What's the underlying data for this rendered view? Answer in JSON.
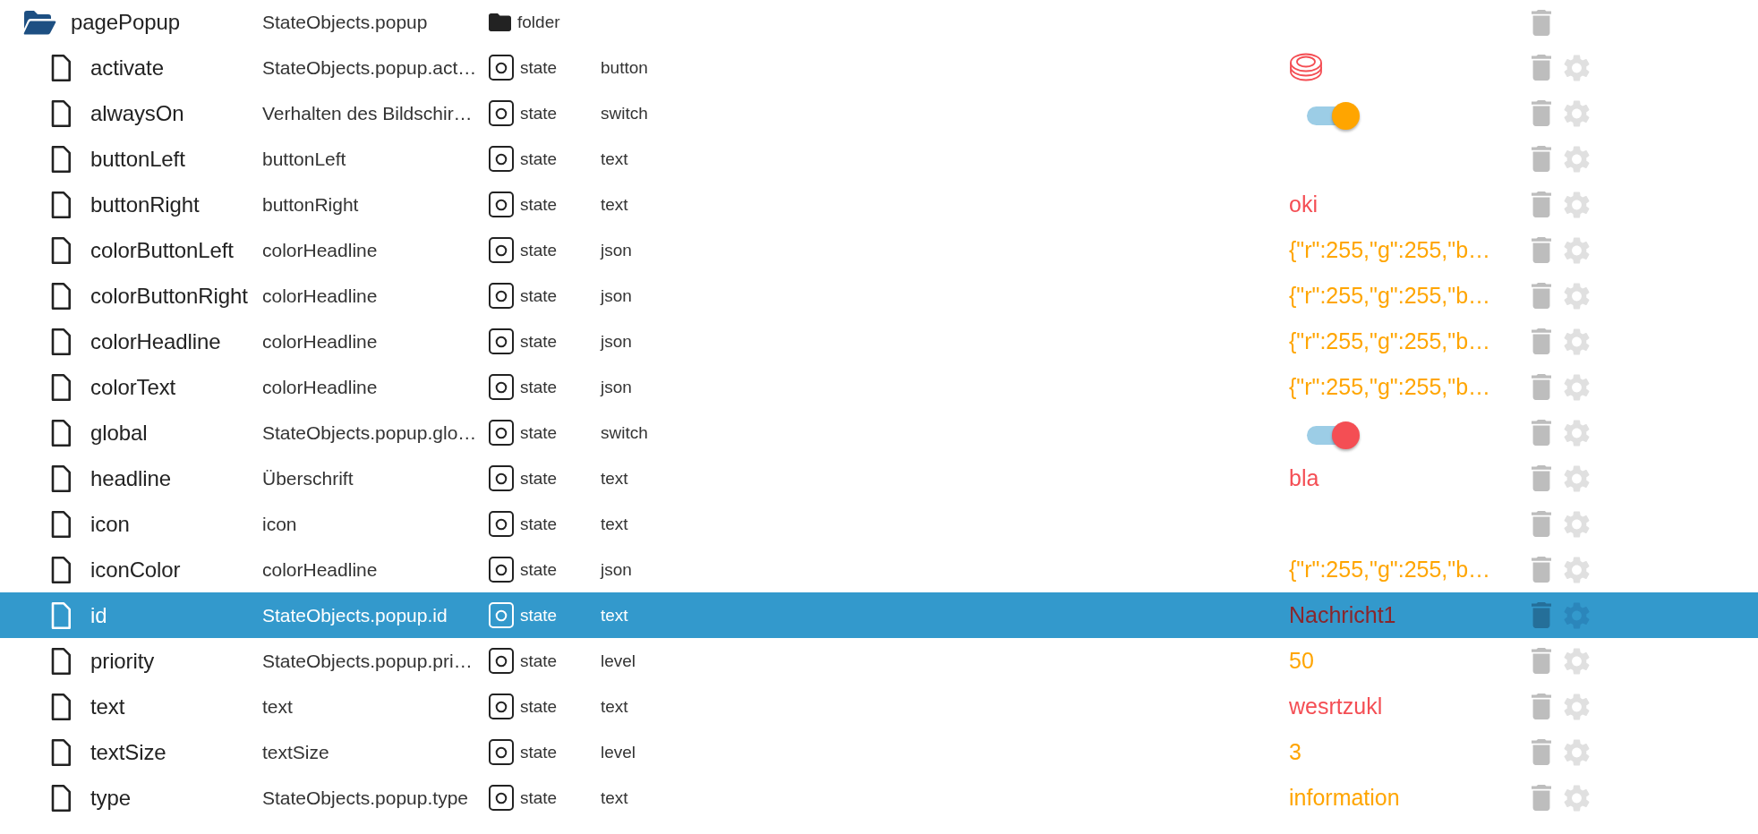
{
  "folder": {
    "name": "pagePopup",
    "description": "StateObjects.popup",
    "type": "folder",
    "expanded": true,
    "selected": false,
    "children": [
      {
        "name": "activate",
        "description": "StateObjects.popup.act…",
        "type": "state",
        "role": "button",
        "kind": "button",
        "color": "#f44e54",
        "selected": false
      },
      {
        "name": "alwaysOn",
        "description": "Verhalten des Bildschir…",
        "type": "state",
        "role": "switch",
        "kind": "switch",
        "on": true,
        "color": "#ffa500",
        "selected": false
      },
      {
        "name": "buttonLeft",
        "description": "buttonLeft",
        "type": "state",
        "role": "text",
        "kind": "text",
        "selected": false
      },
      {
        "name": "buttonRight",
        "description": "buttonRight",
        "type": "state",
        "role": "text",
        "kind": "text",
        "value": "oki",
        "color": "#f44e54",
        "selected": false
      },
      {
        "name": "colorButtonLeft",
        "description": "colorHeadline",
        "type": "state",
        "role": "json",
        "kind": "text",
        "value": "{\"r\":255,\"g\":255,\"b…",
        "color": "#ffa500",
        "selected": false
      },
      {
        "name": "colorButtonRight",
        "description": "colorHeadline",
        "type": "state",
        "role": "json",
        "kind": "text",
        "value": "{\"r\":255,\"g\":255,\"b…",
        "color": "#ffa500",
        "selected": false
      },
      {
        "name": "colorHeadline",
        "description": "colorHeadline",
        "type": "state",
        "role": "json",
        "kind": "text",
        "value": "{\"r\":255,\"g\":255,\"b…",
        "color": "#ffa500",
        "selected": false
      },
      {
        "name": "colorText",
        "description": "colorHeadline",
        "type": "state",
        "role": "json",
        "kind": "text",
        "value": "{\"r\":255,\"g\":255,\"b…",
        "color": "#ffa500",
        "selected": false
      },
      {
        "name": "global",
        "description": "StateObjects.popup.glo…",
        "type": "state",
        "role": "switch",
        "kind": "switch",
        "on": true,
        "color": "#f44e54",
        "selected": false
      },
      {
        "name": "headline",
        "description": "Überschrift",
        "type": "state",
        "role": "text",
        "kind": "text",
        "value": "bla",
        "color": "#f44e54",
        "selected": false
      },
      {
        "name": "icon",
        "description": "icon",
        "type": "state",
        "role": "text",
        "kind": "text",
        "selected": false
      },
      {
        "name": "iconColor",
        "description": "colorHeadline",
        "type": "state",
        "role": "json",
        "kind": "text",
        "value": "{\"r\":255,\"g\":255,\"b…",
        "color": "#ffa500",
        "selected": false
      },
      {
        "name": "id",
        "description": "StateObjects.popup.id",
        "type": "state",
        "role": "text",
        "kind": "text",
        "value": "Nachricht1",
        "color": "#8a262c",
        "selected": true
      },
      {
        "name": "priority",
        "description": "StateObjects.popup.pri…",
        "type": "state",
        "role": "level",
        "kind": "text",
        "value": "50",
        "color": "#ffa500",
        "selected": false
      },
      {
        "name": "text",
        "description": "text",
        "type": "state",
        "role": "text",
        "kind": "text",
        "value": "wesrtzukl",
        "color": "#f44e54",
        "selected": false
      },
      {
        "name": "textSize",
        "description": "textSize",
        "type": "state",
        "role": "level",
        "kind": "text",
        "value": "3",
        "color": "#ffa500",
        "selected": false
      },
      {
        "name": "type",
        "description": "StateObjects.popup.type",
        "type": "state",
        "role": "text",
        "kind": "text",
        "value": "information",
        "color": "#ffa500",
        "selected": false
      }
    ]
  }
}
